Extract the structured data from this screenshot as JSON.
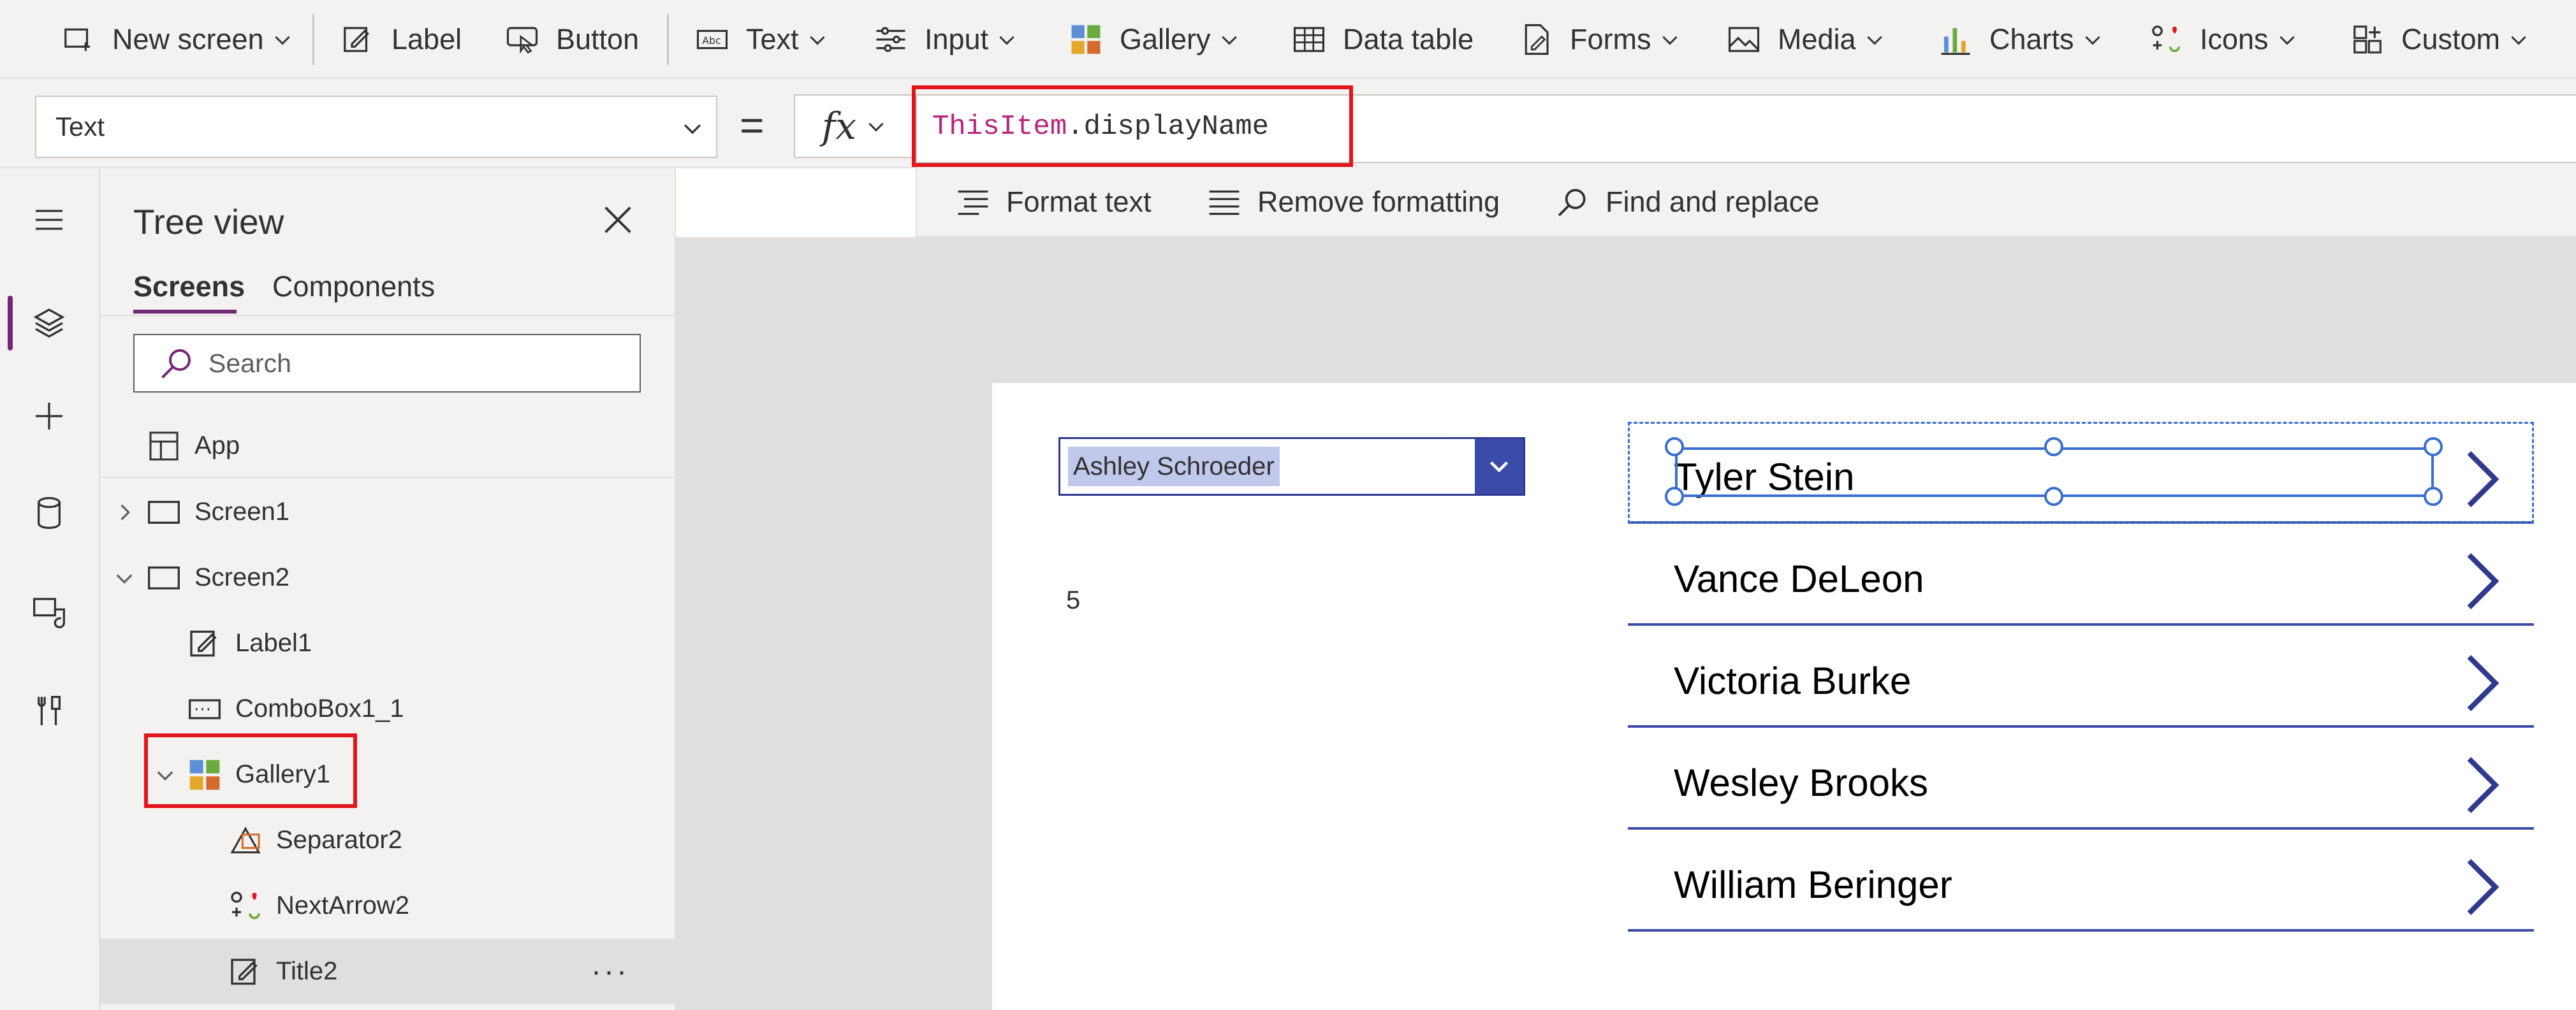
{
  "ribbon": {
    "items": [
      {
        "label": "New screen",
        "icon": "new-screen-icon",
        "dropdown": true
      },
      {
        "label": "Label",
        "icon": "label-icon",
        "dropdown": false
      },
      {
        "label": "Button",
        "icon": "button-icon",
        "dropdown": false
      },
      {
        "label": "Text",
        "icon": "text-icon",
        "dropdown": true
      },
      {
        "label": "Input",
        "icon": "input-icon",
        "dropdown": true
      },
      {
        "label": "Gallery",
        "icon": "gallery-icon",
        "dropdown": true
      },
      {
        "label": "Data table",
        "icon": "data-table-icon",
        "dropdown": false
      },
      {
        "label": "Forms",
        "icon": "forms-icon",
        "dropdown": true
      },
      {
        "label": "Media",
        "icon": "media-icon",
        "dropdown": true
      },
      {
        "label": "Charts",
        "icon": "charts-icon",
        "dropdown": true
      },
      {
        "label": "Icons",
        "icon": "icons-icon",
        "dropdown": true
      },
      {
        "label": "Custom",
        "icon": "custom-icon",
        "dropdown": true
      }
    ]
  },
  "formula_bar": {
    "property": "Text",
    "equals": "=",
    "fx": "fx",
    "formula_keyword": "ThisItem",
    "formula_rest": ".displayName"
  },
  "format_strip": {
    "format_text": "Format text",
    "remove_formatting": "Remove formatting",
    "find_replace": "Find and replace"
  },
  "tree": {
    "title": "Tree view",
    "tabs": [
      "Screens",
      "Components"
    ],
    "search_placeholder": "Search",
    "app_label": "App",
    "nodes": [
      {
        "label": "Screen1",
        "icon": "screen-icon",
        "expander": "collapsed"
      },
      {
        "label": "Screen2",
        "icon": "screen-icon",
        "expander": "expanded"
      },
      {
        "label": "Label1",
        "icon": "label-control-icon",
        "expander": "none"
      },
      {
        "label": "ComboBox1_1",
        "icon": "combobox-icon",
        "expander": "none"
      },
      {
        "label": "Gallery1",
        "icon": "gallery-control-icon",
        "expander": "expanded"
      },
      {
        "label": "Separator2",
        "icon": "separator-icon",
        "expander": "none"
      },
      {
        "label": "NextArrow2",
        "icon": "icon-control-icon",
        "expander": "none"
      },
      {
        "label": "Title2",
        "icon": "label-control-icon",
        "expander": "none"
      }
    ],
    "more": "···"
  },
  "canvas": {
    "combo_value": "Ashley Schroeder",
    "label_value": "5",
    "gallery": [
      "Tyler Stein",
      "Vance DeLeon",
      "Victoria Burke",
      "Wesley Brooks",
      "William Beringer"
    ]
  },
  "colors": {
    "accent": "#742774",
    "highlight": "#e3141b",
    "gallery_blue": "#3a4ca8",
    "selection": "#3a6fd0"
  }
}
